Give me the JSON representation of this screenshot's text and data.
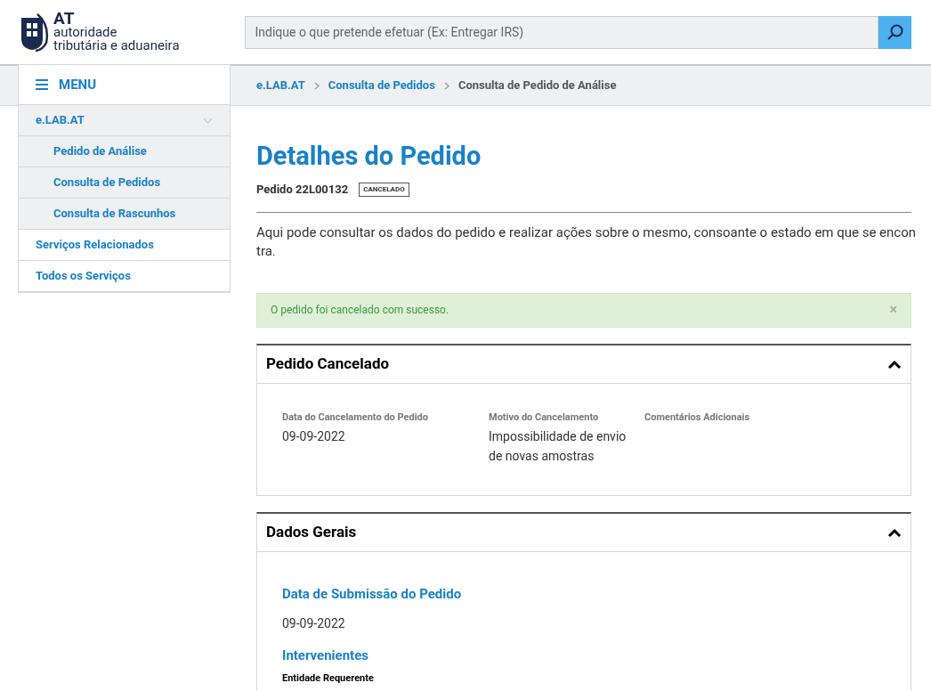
{
  "header": {
    "logo": {
      "abbr": "AT",
      "line1": "autoridade",
      "line2": "tributária e aduaneira"
    },
    "search": {
      "placeholder": "Indique o que pretende efetuar (Ex: Entregar IRS)"
    }
  },
  "menu": {
    "label": "MENU",
    "items": [
      {
        "label": "e.LAB.AT",
        "expanded": true,
        "children": [
          {
            "label": "Pedido de Análise"
          },
          {
            "label": "Consulta de Pedidos"
          },
          {
            "label": "Consulta de Rascunhos"
          }
        ]
      },
      {
        "label": "Serviços Relacionados",
        "expanded": false
      },
      {
        "label": "Todos os Serviços",
        "expanded": false
      }
    ]
  },
  "breadcrumb": [
    {
      "label": "e.LAB.AT",
      "kind": "link"
    },
    {
      "label": "Consulta de Pedidos",
      "kind": "link"
    },
    {
      "label": "Consulta de Pedido de Análise",
      "kind": "current"
    }
  ],
  "page": {
    "title": "Detalhes do Pedido",
    "order": "Pedido 22L00132",
    "status": "CANCELADO",
    "intro": "Aqui pode consultar os dados do pedido e realizar ações sobre o mesmo, consoante o estado em que se encon tra."
  },
  "alert": {
    "message": "O pedido foi cancelado com sucesso.",
    "close": "×"
  },
  "sections": [
    {
      "title": "Pedido Cancelado",
      "expanded": true,
      "kind": "fields",
      "fields": [
        {
          "label": "Data do Cancelamento do Pedido",
          "value": "09-09-2022"
        },
        {
          "label": "Motivo do Cancelamento",
          "value": "Impossibilidade de envio de novas amostras"
        },
        {
          "label": "Comentários Adicionais"
        }
      ]
    },
    {
      "title": "Dados Gerais",
      "expanded": true,
      "kind": "blocks",
      "blocks": [
        {
          "heading": "Data de Submissão do Pedido",
          "value": "09-09-2022"
        },
        {
          "heading": "Intervenientes",
          "sublabel": "Entidade Requerente"
        }
      ]
    }
  ]
}
